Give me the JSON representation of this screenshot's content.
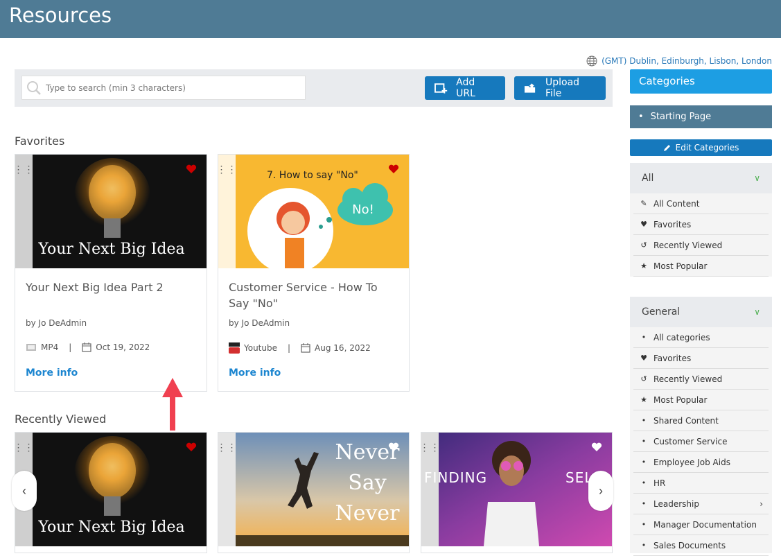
{
  "header": {
    "title": "Resources"
  },
  "timezone": {
    "label": "(GMT) Dublin, Edinburgh, Lisbon, London"
  },
  "toolbar": {
    "search_placeholder": "Type to search (min 3 characters)",
    "add_url_label": "Add URL",
    "upload_file_label": "Upload File"
  },
  "favorites": {
    "title": "Favorites",
    "cards": [
      {
        "thumb_text": "Your Next Big Idea",
        "title": "Your Next Big Idea Part 2",
        "author": "by Jo DeAdmin",
        "type": "MP4",
        "date": "Oct 19, 2022",
        "more": "More info"
      },
      {
        "thumb_text": "7. How to say \"No\"",
        "thumb_bubble": "No!",
        "title": "Customer Service - How To Say \"No\"",
        "author": "by Jo DeAdmin",
        "type": "Youtube",
        "date": "Aug 16, 2022",
        "more": "More info"
      }
    ]
  },
  "recent": {
    "title": "Recently Viewed",
    "cards": [
      {
        "thumb_text": "Your Next Big Idea"
      },
      {
        "thumb_text_1": "Never",
        "thumb_text_2": "Say",
        "thumb_text_3": "Never"
      },
      {
        "thumb_text_1": "FINDING",
        "thumb_text_2": "SEL"
      }
    ]
  },
  "sidebar": {
    "categories_label": "Categories",
    "starting_page": "Starting Page",
    "edit_categories": "Edit Categories",
    "all_group": {
      "label": "All",
      "items": [
        "All Content",
        "Favorites",
        "Recently Viewed",
        "Most Popular"
      ]
    },
    "general_group": {
      "label": "General",
      "items": [
        "All categories",
        "Favorites",
        "Recently Viewed",
        "Most Popular",
        "Shared Content",
        "Customer Service",
        "Employee Job Aids",
        "HR",
        "Leadership",
        "Manager Documentation",
        "Sales Documents"
      ]
    }
  },
  "colors": {
    "topbar": "#4f7b95",
    "accent": "#1679bd",
    "category_header": "#1d9ee3",
    "heart": "#cc0000",
    "link": "#1d86d0"
  }
}
